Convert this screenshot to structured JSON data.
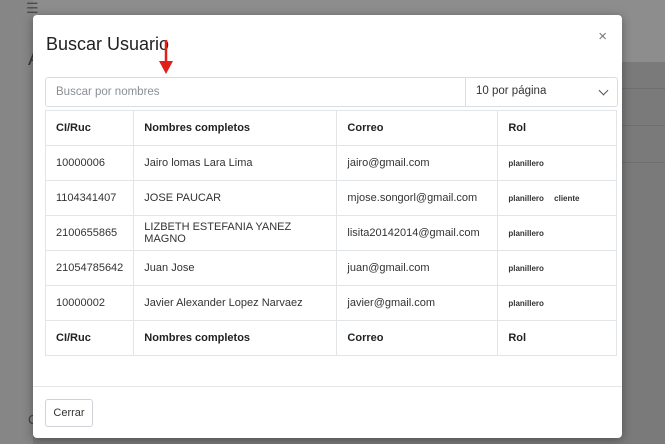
{
  "modal": {
    "title": "Buscar Usuario",
    "close_symbol": "×",
    "close_icon": "close-icon",
    "annotation_icon": "red-arrow-down-icon",
    "annotation_color": "#e0201b"
  },
  "search": {
    "placeholder": "Buscar por nombres",
    "value": ""
  },
  "page_size": {
    "selected": "10 por página"
  },
  "table": {
    "headers": [
      "CI/Ruc",
      "Nombres completos",
      "Correo",
      "Rol"
    ],
    "rows": [
      {
        "ci": "10000006",
        "nombre": "Jairo lomas Lara Lima",
        "correo": "jairo@gmail.com",
        "roles": [
          "planillero"
        ]
      },
      {
        "ci": "1104341407",
        "nombre": "JOSE PAUCAR",
        "correo": "mjose.songorl@gmail.com",
        "roles": [
          "planillero",
          "cliente"
        ]
      },
      {
        "ci": "2100655865",
        "nombre": "LIZBETH ESTEFANIA YANEZ MAGNO",
        "correo": "lisita20142014@gmail.com",
        "roles": [
          "planillero"
        ]
      },
      {
        "ci": "21054785642",
        "nombre": "Juan Jose",
        "correo": "juan@gmail.com",
        "roles": [
          "planillero"
        ]
      },
      {
        "ci": "10000002",
        "nombre": "Javier Alexander Lopez Narvaez",
        "correo": "javier@gmail.com",
        "roles": [
          "planillero"
        ]
      }
    ],
    "footers": [
      "CI/Ruc",
      "Nombres completos",
      "Correo",
      "Rol"
    ]
  },
  "footer": {
    "close_label": "Cerrar"
  },
  "background": {
    "menu_glyph": "☰",
    "header_letter": "A",
    "footer_letter": "C"
  }
}
